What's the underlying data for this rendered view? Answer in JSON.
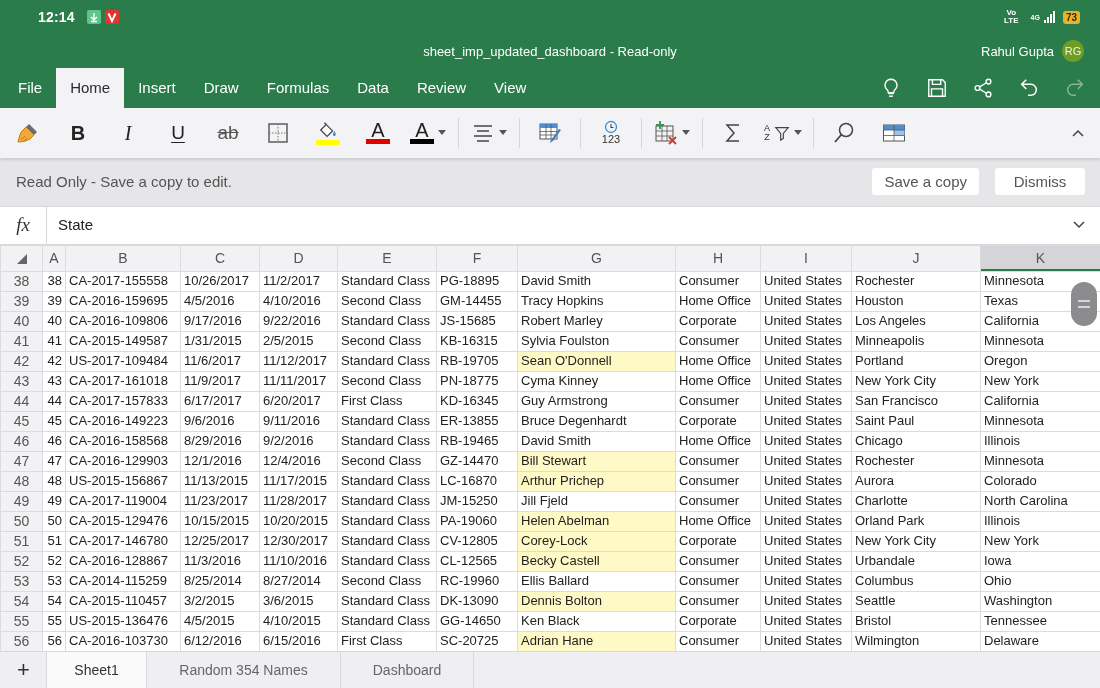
{
  "status_bar": {
    "time": "12:14",
    "network_type": [
      "Vo",
      "LTE"
    ],
    "signal_label": "4G",
    "battery": "73"
  },
  "window": {
    "title": "sheet_imp_updated_dashboard - Read-only"
  },
  "user": {
    "name": "Rahul Gupta",
    "initials": "RG"
  },
  "ribbon_tabs": [
    {
      "label": "File",
      "selected": false
    },
    {
      "label": "Home",
      "selected": true
    },
    {
      "label": "Insert",
      "selected": false
    },
    {
      "label": "Draw",
      "selected": false
    },
    {
      "label": "Formulas",
      "selected": false
    },
    {
      "label": "Data",
      "selected": false
    },
    {
      "label": "Review",
      "selected": false
    },
    {
      "label": "View",
      "selected": false
    }
  ],
  "quick_actions": [
    {
      "kind": "ideas",
      "disabled": false
    },
    {
      "kind": "save",
      "disabled": false
    },
    {
      "kind": "share",
      "disabled": false
    },
    {
      "kind": "undo",
      "disabled": false
    },
    {
      "kind": "redo",
      "disabled": true
    }
  ],
  "toolbar": [
    [
      {
        "kind": "painter",
        "menu": false
      },
      {
        "kind": "bold",
        "label": "B",
        "menu": false
      },
      {
        "kind": "italic",
        "label": "I",
        "menu": false
      },
      {
        "kind": "underline",
        "label": "U",
        "menu": false
      },
      {
        "kind": "strike",
        "label": "ab",
        "menu": false
      },
      {
        "kind": "borders",
        "menu": false
      },
      {
        "kind": "fill",
        "color": "#ffff00",
        "menu": false
      },
      {
        "kind": "font_color",
        "label": "A",
        "color": "#e00000",
        "menu": false
      },
      {
        "kind": "font_color",
        "label": "A",
        "color": "#000000",
        "menu": true
      }
    ],
    [
      {
        "kind": "align",
        "menu": true
      }
    ],
    [
      {
        "kind": "format_table",
        "menu": false
      }
    ],
    [
      {
        "kind": "number_format",
        "label": "123",
        "menu": false
      }
    ],
    [
      {
        "kind": "cells",
        "menu": true
      }
    ],
    [
      {
        "kind": "sum",
        "menu": false
      },
      {
        "kind": "sort_filter",
        "letters": [
          "A",
          "Z"
        ],
        "menu": true
      }
    ],
    [
      {
        "kind": "search",
        "menu": false
      },
      {
        "kind": "table",
        "menu": false
      }
    ]
  ],
  "notice": {
    "message": "Read Only - Save a copy to edit.",
    "buttons": [
      "Save a copy",
      "Dismiss"
    ]
  },
  "formula_bar": {
    "label": "fx",
    "value": "State"
  },
  "columns": [
    {
      "label": "A",
      "selected": false
    },
    {
      "label": "B",
      "selected": false
    },
    {
      "label": "C",
      "selected": false
    },
    {
      "label": "D",
      "selected": false
    },
    {
      "label": "E",
      "selected": false
    },
    {
      "label": "F",
      "selected": false
    },
    {
      "label": "G",
      "selected": false
    },
    {
      "label": "H",
      "selected": false
    },
    {
      "label": "I",
      "selected": false
    },
    {
      "label": "J",
      "selected": false
    },
    {
      "label": "K",
      "selected": true
    }
  ],
  "rows": [
    {
      "header": "38",
      "cells": [
        "38",
        "CA-2017-155558",
        "10/26/2017",
        "11/2/2017",
        "Standard Class",
        "PG-18895",
        "David Smith",
        "Consumer",
        "United States",
        "Rochester",
        "Minnesota"
      ],
      "g_highlighted": false
    },
    {
      "header": "39",
      "cells": [
        "39",
        "CA-2016-159695",
        "4/5/2016",
        "4/10/2016",
        "Second Class",
        "GM-14455",
        "Tracy Hopkins",
        "Home Office",
        "United States",
        "Houston",
        "Texas"
      ],
      "g_highlighted": false
    },
    {
      "header": "40",
      "cells": [
        "40",
        "CA-2016-109806",
        "9/17/2016",
        "9/22/2016",
        "Standard Class",
        "JS-15685",
        "Robert Marley",
        "Corporate",
        "United States",
        "Los Angeles",
        "California"
      ],
      "g_highlighted": false
    },
    {
      "header": "41",
      "cells": [
        "41",
        "CA-2015-149587",
        "1/31/2015",
        "2/5/2015",
        "Second Class",
        "KB-16315",
        "Sylvia Foulston",
        "Consumer",
        "United States",
        "Minneapolis",
        "Minnesota"
      ],
      "g_highlighted": false
    },
    {
      "header": "42",
      "cells": [
        "42",
        "US-2017-109484",
        "11/6/2017",
        "11/12/2017",
        "Standard Class",
        "RB-19705",
        "Sean O'Donnell",
        "Home Office",
        "United States",
        "Portland",
        "Oregon"
      ],
      "g_highlighted": true
    },
    {
      "header": "43",
      "cells": [
        "43",
        "CA-2017-161018",
        "11/9/2017",
        "11/11/2017",
        "Second Class",
        "PN-18775",
        "Cyma Kinney",
        "Home Office",
        "United States",
        "New York City",
        "New York"
      ],
      "g_highlighted": false
    },
    {
      "header": "44",
      "cells": [
        "44",
        "CA-2017-157833",
        "6/17/2017",
        "6/20/2017",
        "First Class",
        "KD-16345",
        "Guy Armstrong",
        "Consumer",
        "United States",
        "San Francisco",
        "California"
      ],
      "g_highlighted": false
    },
    {
      "header": "45",
      "cells": [
        "45",
        "CA-2016-149223",
        "9/6/2016",
        "9/11/2016",
        "Standard Class",
        "ER-13855",
        "Bruce Degenhardt",
        "Corporate",
        "United States",
        "Saint Paul",
        "Minnesota"
      ],
      "g_highlighted": false
    },
    {
      "header": "46",
      "cells": [
        "46",
        "CA-2016-158568",
        "8/29/2016",
        "9/2/2016",
        "Standard Class",
        "RB-19465",
        "David Smith",
        "Home Office",
        "United States",
        "Chicago",
        "Illinois"
      ],
      "g_highlighted": false
    },
    {
      "header": "47",
      "cells": [
        "47",
        "CA-2016-129903",
        "12/1/2016",
        "12/4/2016",
        "Second Class",
        "GZ-14470",
        "Bill Stewart",
        "Consumer",
        "United States",
        "Rochester",
        "Minnesota"
      ],
      "g_highlighted": true
    },
    {
      "header": "48",
      "cells": [
        "48",
        "US-2015-156867",
        "11/13/2015",
        "11/17/2015",
        "Standard Class",
        "LC-16870",
        "Arthur Prichep",
        "Consumer",
        "United States",
        "Aurora",
        "Colorado"
      ],
      "g_highlighted": true
    },
    {
      "header": "49",
      "cells": [
        "49",
        "CA-2017-119004",
        "11/23/2017",
        "11/28/2017",
        "Standard Class",
        "JM-15250",
        "Jill Fjeld",
        "Consumer",
        "United States",
        "Charlotte",
        "North Carolina"
      ],
      "g_highlighted": false
    },
    {
      "header": "50",
      "cells": [
        "50",
        "CA-2015-129476",
        "10/15/2015",
        "10/20/2015",
        "Standard Class",
        "PA-19060",
        "Helen Abelman",
        "Home Office",
        "United States",
        "Orland Park",
        "Illinois"
      ],
      "g_highlighted": true
    },
    {
      "header": "51",
      "cells": [
        "51",
        "CA-2017-146780",
        "12/25/2017",
        "12/30/2017",
        "Standard Class",
        "CV-12805",
        "Corey-Lock",
        "Corporate",
        "United States",
        "New York City",
        "New York"
      ],
      "g_highlighted": true
    },
    {
      "header": "52",
      "cells": [
        "52",
        "CA-2016-128867",
        "11/3/2016",
        "11/10/2016",
        "Standard Class",
        "CL-12565",
        "Becky Castell",
        "Consumer",
        "United States",
        "Urbandale",
        "Iowa"
      ],
      "g_highlighted": true
    },
    {
      "header": "53",
      "cells": [
        "53",
        "CA-2014-115259",
        "8/25/2014",
        "8/27/2014",
        "Second Class",
        "RC-19960",
        "Ellis Ballard",
        "Consumer",
        "United States",
        "Columbus",
        "Ohio"
      ],
      "g_highlighted": false
    },
    {
      "header": "54",
      "cells": [
        "54",
        "CA-2015-110457",
        "3/2/2015",
        "3/6/2015",
        "Standard Class",
        "DK-13090",
        "Dennis Bolton",
        "Consumer",
        "United States",
        "Seattle",
        "Washington"
      ],
      "g_highlighted": true
    },
    {
      "header": "55",
      "cells": [
        "55",
        "US-2015-136476",
        "4/5/2015",
        "4/10/2015",
        "Standard Class",
        "GG-14650",
        "Ken Black",
        "Corporate",
        "United States",
        "Bristol",
        "Tennessee"
      ],
      "g_highlighted": false
    },
    {
      "header": "56",
      "cells": [
        "56",
        "CA-2016-103730",
        "6/12/2016",
        "6/15/2016",
        "First Class",
        "SC-20725",
        "Adrian Hane",
        "Consumer",
        "United States",
        "Wilmington",
        "Delaware"
      ],
      "g_highlighted": true
    }
  ],
  "add_sheet": "+",
  "sheet_tabs": [
    {
      "label": "Sheet1",
      "selected": true
    },
    {
      "label": "Random 354 Names",
      "selected": false
    },
    {
      "label": "Dashboard",
      "selected": false
    }
  ]
}
